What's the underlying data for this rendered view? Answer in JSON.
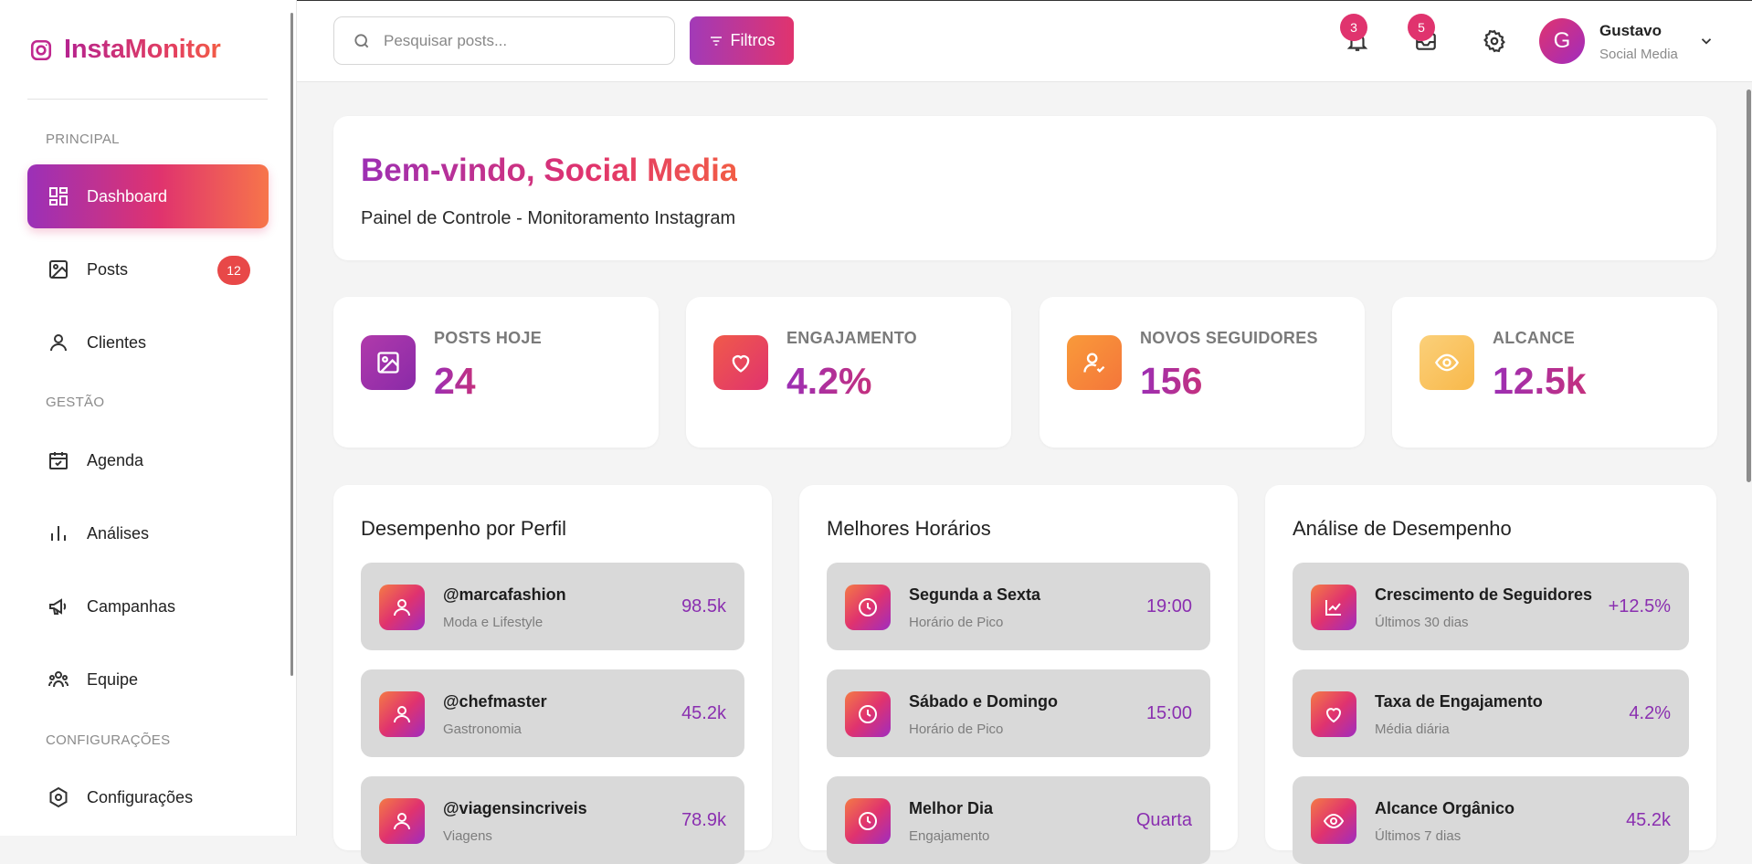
{
  "app": {
    "name": "InstaMonitor"
  },
  "sidebar": {
    "sections": [
      {
        "title": "PRINCIPAL"
      },
      {
        "title": "GESTÃO"
      },
      {
        "title": "CONFIGURAÇÕES"
      }
    ],
    "items": [
      {
        "label": "Dashboard",
        "icon": "dashboard-icon",
        "active": true
      },
      {
        "label": "Posts",
        "icon": "image-icon",
        "badge": "12"
      },
      {
        "label": "Clientes",
        "icon": "user-icon"
      },
      {
        "label": "Agenda",
        "icon": "calendar-icon"
      },
      {
        "label": "Análises",
        "icon": "bar-chart-icon"
      },
      {
        "label": "Campanhas",
        "icon": "megaphone-icon"
      },
      {
        "label": "Equipe",
        "icon": "team-icon"
      },
      {
        "label": "Configurações",
        "icon": "settings-hex-icon"
      }
    ]
  },
  "topbar": {
    "search_placeholder": "Pesquisar posts...",
    "filter_label": "Filtros",
    "notifications_count": "3",
    "messages_count": "5",
    "user": {
      "initial": "G",
      "name": "Gustavo",
      "role": "Social Media"
    }
  },
  "welcome": {
    "title": "Bem-vindo, Social Media",
    "subtitle": "Painel de Controle - Monitoramento Instagram"
  },
  "stats": [
    {
      "label": "POSTS HOJE",
      "value": "24",
      "icon": "image-icon",
      "color": "#9c2fb4"
    },
    {
      "label": "ENGAJAMENTO",
      "value": "4.2%",
      "icon": "heart-icon",
      "color": "#e8494a"
    },
    {
      "label": "NOVOS SEGUIDORES",
      "value": "156",
      "icon": "user-check-icon",
      "color": "#f78a3a"
    },
    {
      "label": "ALCANCE",
      "value": "12.5k",
      "icon": "eye-icon",
      "color": "#f8c060"
    }
  ],
  "panels": {
    "profiles": {
      "title": "Desempenho por Perfil",
      "rows": [
        {
          "title": "@marcafashion",
          "subtitle": "Moda e Lifestyle",
          "value": "98.5k"
        },
        {
          "title": "@chefmaster",
          "subtitle": "Gastronomia",
          "value": "45.2k"
        },
        {
          "title": "@viagensincriveis",
          "subtitle": "Viagens",
          "value": "78.9k"
        }
      ]
    },
    "hours": {
      "title": "Melhores Horários",
      "rows": [
        {
          "title": "Segunda a Sexta",
          "subtitle": "Horário de Pico",
          "value": "19:00"
        },
        {
          "title": "Sábado e Domingo",
          "subtitle": "Horário de Pico",
          "value": "15:00"
        },
        {
          "title": "Melhor Dia",
          "subtitle": "Engajamento",
          "value": "Quarta"
        }
      ]
    },
    "performance": {
      "title": "Análise de Desempenho",
      "rows": [
        {
          "title": "Crescimento de Seguidores",
          "subtitle": "Últimos 30 dias",
          "value": "+12.5%",
          "icon": "trend-icon"
        },
        {
          "title": "Taxa de Engajamento",
          "subtitle": "Média diária",
          "value": "4.2%",
          "icon": "heart-icon"
        },
        {
          "title": "Alcance Orgânico",
          "subtitle": "Últimos 7 dias",
          "value": "45.2k",
          "icon": "eye-icon"
        }
      ]
    }
  }
}
